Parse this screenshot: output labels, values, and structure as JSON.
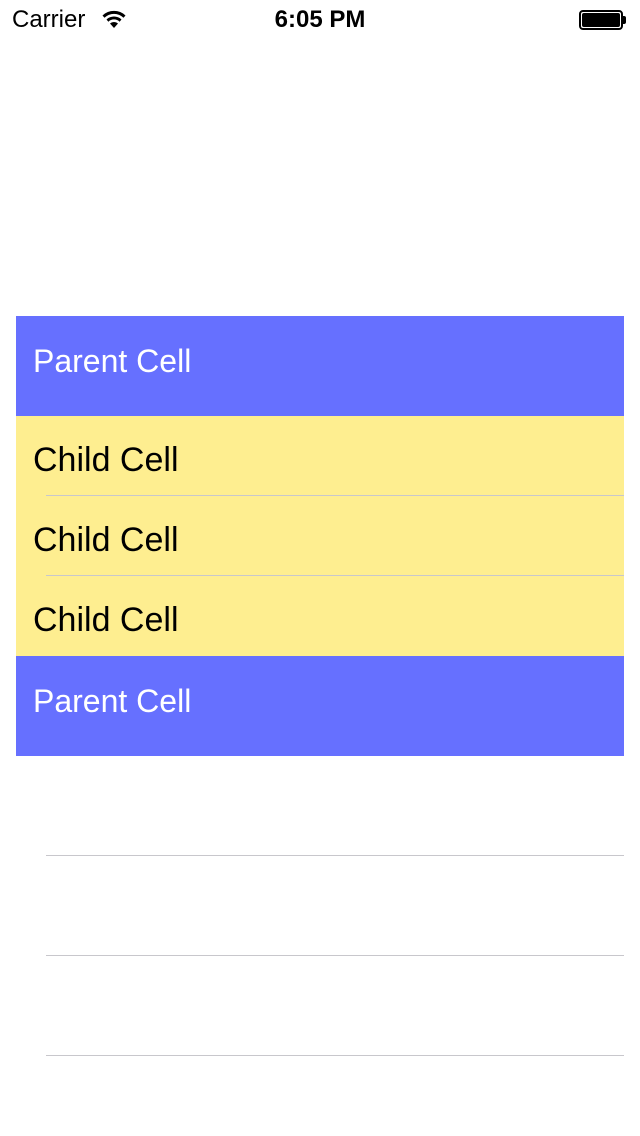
{
  "status_bar": {
    "carrier": "Carrier",
    "time": "6:05 PM"
  },
  "colors": {
    "parent_cell_bg": "#6670ff",
    "child_cell_bg": "#feee90",
    "separator": "#c8c7cc"
  },
  "table": {
    "rows": [
      {
        "type": "parent",
        "label": "Parent Cell"
      },
      {
        "type": "child",
        "label": "Child Cell"
      },
      {
        "type": "child",
        "label": "Child Cell"
      },
      {
        "type": "child",
        "label": "Child Cell"
      },
      {
        "type": "parent",
        "label": "Parent Cell"
      }
    ]
  }
}
